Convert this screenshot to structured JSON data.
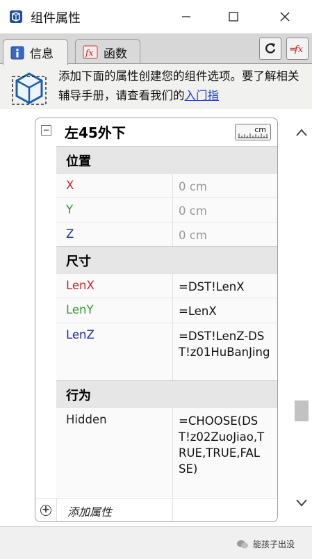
{
  "window": {
    "title": "组件属性",
    "minimize_icon": "minimize-icon",
    "maximize_icon": "maximize-icon",
    "close_icon": "close-icon"
  },
  "tabs": [
    {
      "label": "信息",
      "icon": "info-icon",
      "active": true
    },
    {
      "label": "函数",
      "icon": "function-icon",
      "active": false
    }
  ],
  "toolbar": {
    "refresh_icon": "refresh-icon",
    "formula_icon": "fx-icon"
  },
  "info": {
    "text": "添加下面的属性创建您的组件选项。要了解相关辅导手册，请查看我们的",
    "link": "入门指"
  },
  "component": {
    "name": "左45外下",
    "unit": "cm"
  },
  "sections": [
    {
      "title": "位置",
      "rows": [
        {
          "name": "X",
          "value": "0 cm",
          "name_color": "#c0262c",
          "muted": true
        },
        {
          "name": "Y",
          "value": "0 cm",
          "name_color": "#2e9c2e",
          "muted": true
        },
        {
          "name": "Z",
          "value": "0 cm",
          "name_color": "#1d2a9c",
          "muted": true
        }
      ]
    },
    {
      "title": "尺寸",
      "rows": [
        {
          "name": "LenX",
          "value": "=DST!LenX",
          "name_color": "#c0262c"
        },
        {
          "name": "LenY",
          "value": "=LenX",
          "name_color": "#2e9c2e"
        },
        {
          "name": "LenZ",
          "value": "=DST!LenZ-DST!z01HuBanJing",
          "name_color": "#1d2a9c"
        }
      ]
    },
    {
      "title": "行为",
      "rows": [
        {
          "name": "Hidden",
          "value": "=CHOOSE(DST!z02ZuoJiao,TRUE,TRUE,FALSE)",
          "name_color": "#222222"
        }
      ]
    }
  ],
  "add_attribute_label": "添加属性",
  "watermark": "能孩子出没",
  "colors": {
    "link": "#1a3bd6",
    "section_bg": "#e6e6e6",
    "tab_bar": "#d7d7d7"
  }
}
